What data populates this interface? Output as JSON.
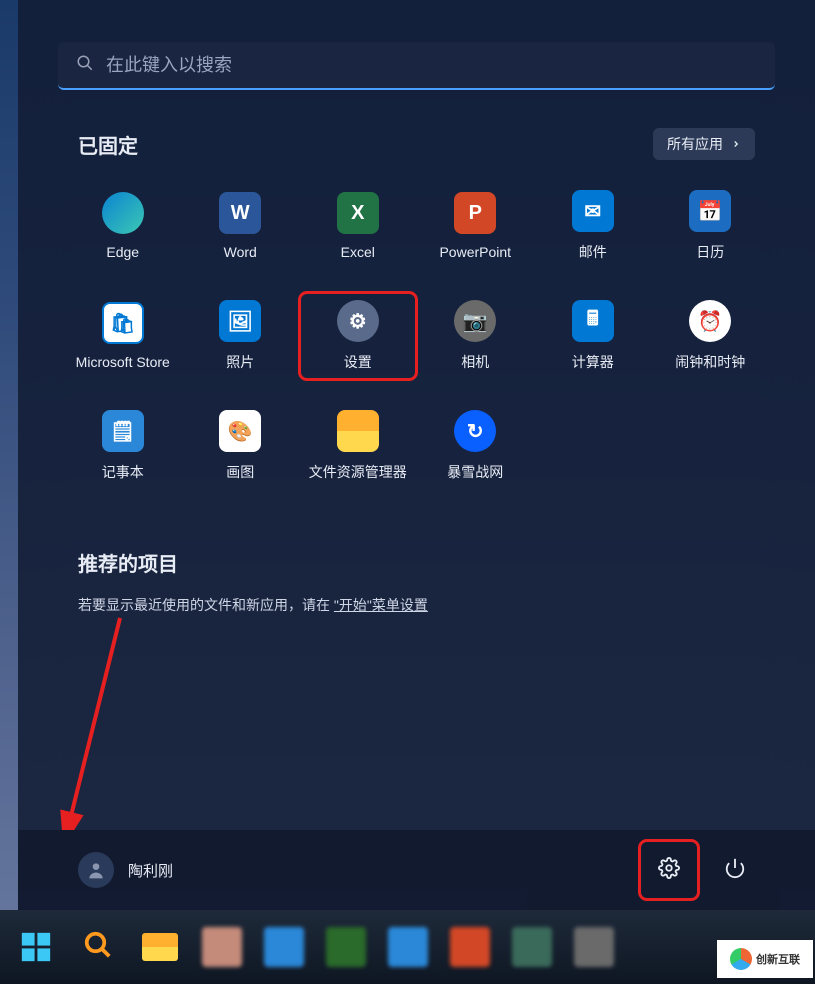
{
  "search": {
    "placeholder": "在此键入以搜索"
  },
  "pinned": {
    "title": "已固定",
    "all_apps": "所有应用",
    "apps": [
      {
        "label": "Edge",
        "icon": "i-edge",
        "letter": "",
        "name": "app-edge"
      },
      {
        "label": "Word",
        "icon": "i-word",
        "letter": "W",
        "name": "app-word"
      },
      {
        "label": "Excel",
        "icon": "i-excel",
        "letter": "X",
        "name": "app-excel"
      },
      {
        "label": "PowerPoint",
        "icon": "i-ppt",
        "letter": "P",
        "name": "app-powerpoint"
      },
      {
        "label": "邮件",
        "icon": "i-mail",
        "letter": "✉",
        "name": "app-mail"
      },
      {
        "label": "日历",
        "icon": "i-cal",
        "letter": "📅",
        "name": "app-calendar"
      },
      {
        "label": "Microsoft Store",
        "icon": "i-store",
        "letter": "🛍",
        "name": "app-microsoft-store"
      },
      {
        "label": "照片",
        "icon": "i-photos",
        "letter": "🖼",
        "name": "app-photos"
      },
      {
        "label": "设置",
        "icon": "i-settings",
        "letter": "⚙",
        "name": "app-settings",
        "highlight": true
      },
      {
        "label": "相机",
        "icon": "i-camera",
        "letter": "📷",
        "name": "app-camera"
      },
      {
        "label": "计算器",
        "icon": "i-calc",
        "letter": "🖩",
        "name": "app-calculator"
      },
      {
        "label": "闹钟和时钟",
        "icon": "i-clock",
        "letter": "⏰",
        "name": "app-alarms-clock"
      },
      {
        "label": "记事本",
        "icon": "i-notepad",
        "letter": "🗒",
        "name": "app-notepad"
      },
      {
        "label": "画图",
        "icon": "i-paint",
        "letter": "🎨",
        "name": "app-paint"
      },
      {
        "label": "文件资源管理器",
        "icon": "i-files",
        "letter": "",
        "name": "app-file-explorer"
      },
      {
        "label": "暴雪战网",
        "icon": "i-battlenet",
        "letter": "↻",
        "name": "app-battlenet"
      }
    ]
  },
  "recommended": {
    "title": "推荐的项目",
    "prefix": "若要显示最近使用的文件和新应用，请在 ",
    "link": "\"开始\"菜单设置"
  },
  "footer": {
    "username": "陶利刚"
  },
  "watermark": "创新互联",
  "colors": {
    "highlight_red": "#e62020",
    "accent_blue": "#4aa0ff"
  }
}
